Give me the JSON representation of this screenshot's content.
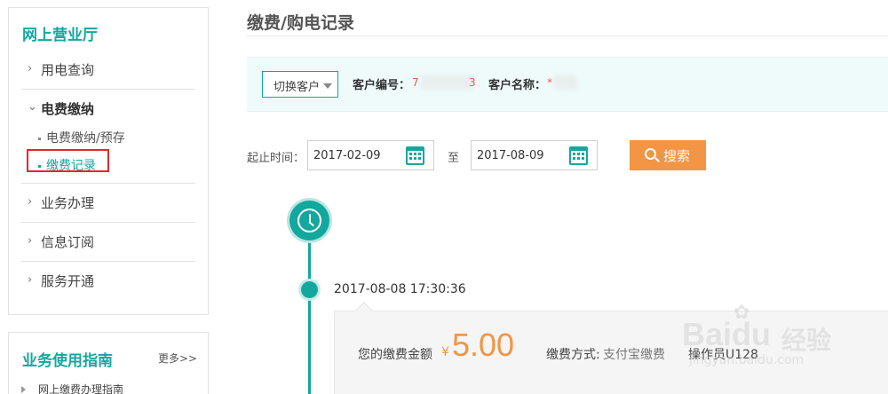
{
  "sidebar": {
    "title": "网上营业厅",
    "items": [
      {
        "label": "用电查询"
      },
      {
        "label": "电费缴纳"
      },
      {
        "label": "业务办理"
      },
      {
        "label": "信息订阅"
      },
      {
        "label": "服务开通"
      }
    ],
    "sub_items": [
      {
        "label": "电费缴纳/预存"
      },
      {
        "label": "缴费记录"
      }
    ]
  },
  "guide": {
    "title": "业务使用指南",
    "more": "更多>>",
    "items": [
      {
        "label": "网上缴费办理指南"
      }
    ]
  },
  "main": {
    "title": "缴费/购电记录",
    "customer": {
      "switch_label": "切换客户",
      "number_label": "客户编号：",
      "number_prefix": "7",
      "number_suffix": "3",
      "name_label": "客户名称：",
      "name_prefix": "*"
    },
    "filter": {
      "range_label": "起止时间：",
      "start_date": "2017-02-09",
      "to_label": "至",
      "end_date": "2017-08-09",
      "search_label": "搜索"
    },
    "records": [
      {
        "time": "2017-08-08 17:30:36",
        "amount_label": "您的缴费金额",
        "currency": "¥",
        "amount": "5.00",
        "pay_method_label": "缴费方式:",
        "pay_method": "支付宝缴费",
        "operator_label": "操作员U128"
      }
    ]
  },
  "watermark": {
    "brand": "Baidu",
    "brand_cn": "经验",
    "url": "jingyan.baidu.com"
  },
  "colors": {
    "accent": "#13a89e",
    "orange": "#f39544",
    "highlight_box": "#e6262b"
  }
}
